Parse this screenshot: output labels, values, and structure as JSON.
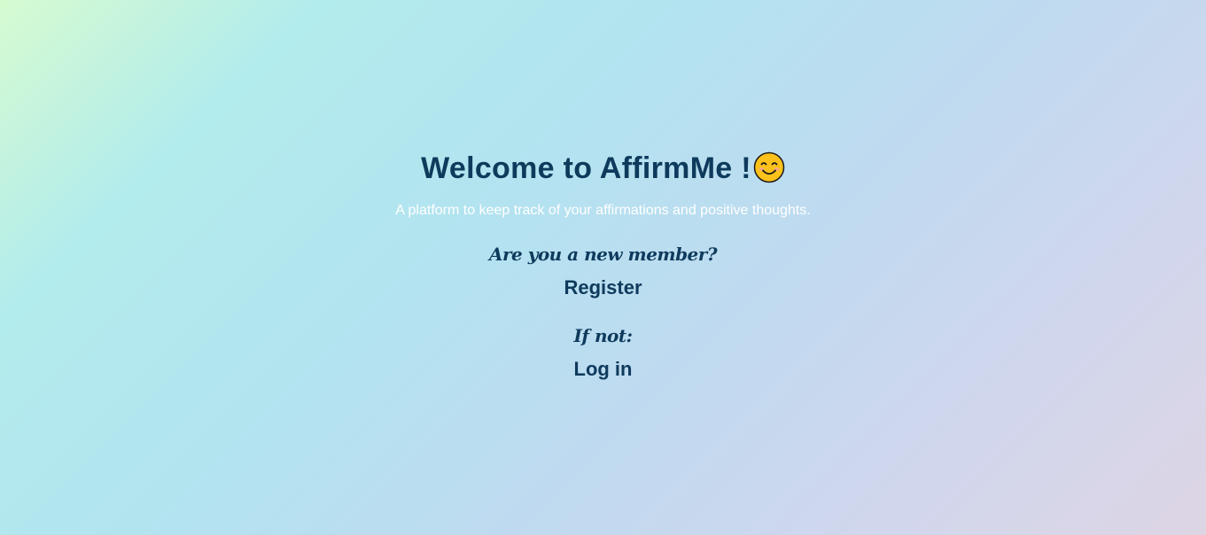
{
  "welcome": {
    "title": "Welcome to AffirmMe !",
    "emoji": "smiling-face-icon",
    "subtitle": "A platform to keep track of your affirmations and positive thoughts."
  },
  "register_section": {
    "prompt": "Are you a new member?",
    "link_label": "Register"
  },
  "login_section": {
    "prompt": "If not:",
    "link_label": "Log in"
  },
  "colors": {
    "text_primary": "#0e3a5c",
    "subtitle": "#ffffff"
  }
}
